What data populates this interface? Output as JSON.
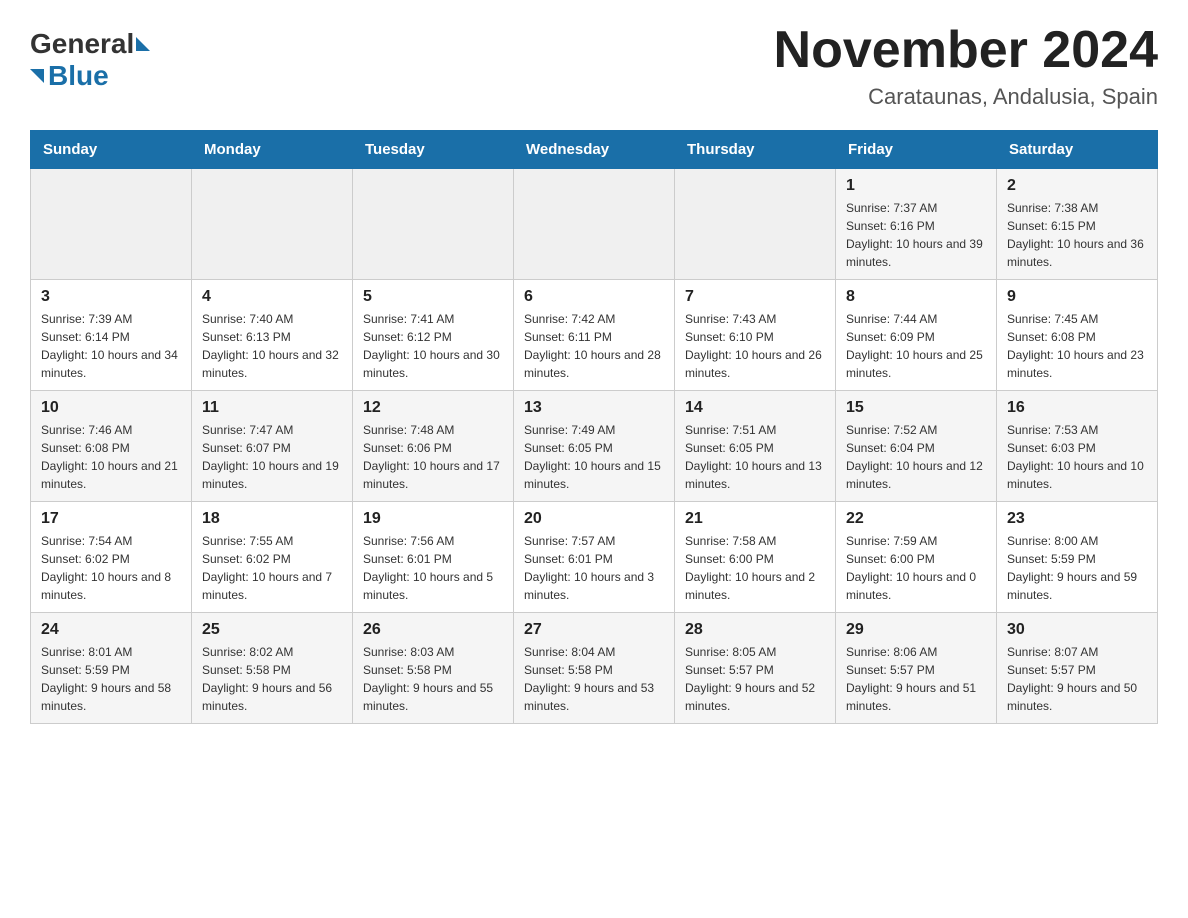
{
  "header": {
    "logo_general": "General",
    "logo_blue": "Blue",
    "month_title": "November 2024",
    "location": "Carataunas, Andalusia, Spain"
  },
  "weekdays": [
    "Sunday",
    "Monday",
    "Tuesday",
    "Wednesday",
    "Thursday",
    "Friday",
    "Saturday"
  ],
  "weeks": [
    [
      {
        "day": "",
        "sunrise": "",
        "sunset": "",
        "daylight": ""
      },
      {
        "day": "",
        "sunrise": "",
        "sunset": "",
        "daylight": ""
      },
      {
        "day": "",
        "sunrise": "",
        "sunset": "",
        "daylight": ""
      },
      {
        "day": "",
        "sunrise": "",
        "sunset": "",
        "daylight": ""
      },
      {
        "day": "",
        "sunrise": "",
        "sunset": "",
        "daylight": ""
      },
      {
        "day": "1",
        "sunrise": "Sunrise: 7:37 AM",
        "sunset": "Sunset: 6:16 PM",
        "daylight": "Daylight: 10 hours and 39 minutes."
      },
      {
        "day": "2",
        "sunrise": "Sunrise: 7:38 AM",
        "sunset": "Sunset: 6:15 PM",
        "daylight": "Daylight: 10 hours and 36 minutes."
      }
    ],
    [
      {
        "day": "3",
        "sunrise": "Sunrise: 7:39 AM",
        "sunset": "Sunset: 6:14 PM",
        "daylight": "Daylight: 10 hours and 34 minutes."
      },
      {
        "day": "4",
        "sunrise": "Sunrise: 7:40 AM",
        "sunset": "Sunset: 6:13 PM",
        "daylight": "Daylight: 10 hours and 32 minutes."
      },
      {
        "day": "5",
        "sunrise": "Sunrise: 7:41 AM",
        "sunset": "Sunset: 6:12 PM",
        "daylight": "Daylight: 10 hours and 30 minutes."
      },
      {
        "day": "6",
        "sunrise": "Sunrise: 7:42 AM",
        "sunset": "Sunset: 6:11 PM",
        "daylight": "Daylight: 10 hours and 28 minutes."
      },
      {
        "day": "7",
        "sunrise": "Sunrise: 7:43 AM",
        "sunset": "Sunset: 6:10 PM",
        "daylight": "Daylight: 10 hours and 26 minutes."
      },
      {
        "day": "8",
        "sunrise": "Sunrise: 7:44 AM",
        "sunset": "Sunset: 6:09 PM",
        "daylight": "Daylight: 10 hours and 25 minutes."
      },
      {
        "day": "9",
        "sunrise": "Sunrise: 7:45 AM",
        "sunset": "Sunset: 6:08 PM",
        "daylight": "Daylight: 10 hours and 23 minutes."
      }
    ],
    [
      {
        "day": "10",
        "sunrise": "Sunrise: 7:46 AM",
        "sunset": "Sunset: 6:08 PM",
        "daylight": "Daylight: 10 hours and 21 minutes."
      },
      {
        "day": "11",
        "sunrise": "Sunrise: 7:47 AM",
        "sunset": "Sunset: 6:07 PM",
        "daylight": "Daylight: 10 hours and 19 minutes."
      },
      {
        "day": "12",
        "sunrise": "Sunrise: 7:48 AM",
        "sunset": "Sunset: 6:06 PM",
        "daylight": "Daylight: 10 hours and 17 minutes."
      },
      {
        "day": "13",
        "sunrise": "Sunrise: 7:49 AM",
        "sunset": "Sunset: 6:05 PM",
        "daylight": "Daylight: 10 hours and 15 minutes."
      },
      {
        "day": "14",
        "sunrise": "Sunrise: 7:51 AM",
        "sunset": "Sunset: 6:05 PM",
        "daylight": "Daylight: 10 hours and 13 minutes."
      },
      {
        "day": "15",
        "sunrise": "Sunrise: 7:52 AM",
        "sunset": "Sunset: 6:04 PM",
        "daylight": "Daylight: 10 hours and 12 minutes."
      },
      {
        "day": "16",
        "sunrise": "Sunrise: 7:53 AM",
        "sunset": "Sunset: 6:03 PM",
        "daylight": "Daylight: 10 hours and 10 minutes."
      }
    ],
    [
      {
        "day": "17",
        "sunrise": "Sunrise: 7:54 AM",
        "sunset": "Sunset: 6:02 PM",
        "daylight": "Daylight: 10 hours and 8 minutes."
      },
      {
        "day": "18",
        "sunrise": "Sunrise: 7:55 AM",
        "sunset": "Sunset: 6:02 PM",
        "daylight": "Daylight: 10 hours and 7 minutes."
      },
      {
        "day": "19",
        "sunrise": "Sunrise: 7:56 AM",
        "sunset": "Sunset: 6:01 PM",
        "daylight": "Daylight: 10 hours and 5 minutes."
      },
      {
        "day": "20",
        "sunrise": "Sunrise: 7:57 AM",
        "sunset": "Sunset: 6:01 PM",
        "daylight": "Daylight: 10 hours and 3 minutes."
      },
      {
        "day": "21",
        "sunrise": "Sunrise: 7:58 AM",
        "sunset": "Sunset: 6:00 PM",
        "daylight": "Daylight: 10 hours and 2 minutes."
      },
      {
        "day": "22",
        "sunrise": "Sunrise: 7:59 AM",
        "sunset": "Sunset: 6:00 PM",
        "daylight": "Daylight: 10 hours and 0 minutes."
      },
      {
        "day": "23",
        "sunrise": "Sunrise: 8:00 AM",
        "sunset": "Sunset: 5:59 PM",
        "daylight": "Daylight: 9 hours and 59 minutes."
      }
    ],
    [
      {
        "day": "24",
        "sunrise": "Sunrise: 8:01 AM",
        "sunset": "Sunset: 5:59 PM",
        "daylight": "Daylight: 9 hours and 58 minutes."
      },
      {
        "day": "25",
        "sunrise": "Sunrise: 8:02 AM",
        "sunset": "Sunset: 5:58 PM",
        "daylight": "Daylight: 9 hours and 56 minutes."
      },
      {
        "day": "26",
        "sunrise": "Sunrise: 8:03 AM",
        "sunset": "Sunset: 5:58 PM",
        "daylight": "Daylight: 9 hours and 55 minutes."
      },
      {
        "day": "27",
        "sunrise": "Sunrise: 8:04 AM",
        "sunset": "Sunset: 5:58 PM",
        "daylight": "Daylight: 9 hours and 53 minutes."
      },
      {
        "day": "28",
        "sunrise": "Sunrise: 8:05 AM",
        "sunset": "Sunset: 5:57 PM",
        "daylight": "Daylight: 9 hours and 52 minutes."
      },
      {
        "day": "29",
        "sunrise": "Sunrise: 8:06 AM",
        "sunset": "Sunset: 5:57 PM",
        "daylight": "Daylight: 9 hours and 51 minutes."
      },
      {
        "day": "30",
        "sunrise": "Sunrise: 8:07 AM",
        "sunset": "Sunset: 5:57 PM",
        "daylight": "Daylight: 9 hours and 50 minutes."
      }
    ]
  ]
}
